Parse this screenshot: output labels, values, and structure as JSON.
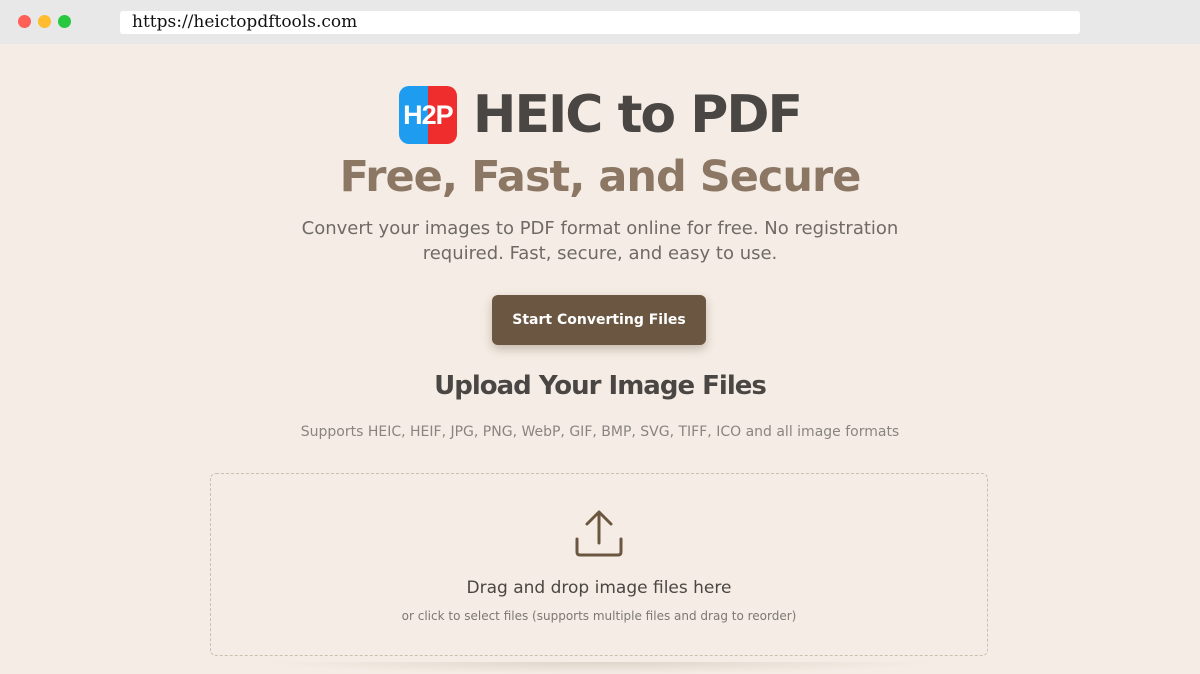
{
  "browser": {
    "url": "https://heictopdftools.com"
  },
  "hero": {
    "logo_text": "H2P",
    "title": "HEIC to PDF",
    "subtitle": "Free, Fast, and Secure",
    "description": "Convert your images to PDF format online for free. No registration required. Fast, secure, and easy to use.",
    "cta_label": "Start Converting Files"
  },
  "upload": {
    "title": "Upload Your Image Files",
    "formats": "Supports HEIC, HEIF, JPG, PNG, WebP, GIF, BMP, SVG, TIFF, ICO and all image formats",
    "dropzone_main": "Drag and drop image files here",
    "dropzone_sub": "or click to select files (supports multiple files and drag to reorder)"
  },
  "colors": {
    "background": "#f5ede5",
    "accent_brown": "#6b5641",
    "subtitle_brown": "#8b7764",
    "logo_blue": "#1e9cf0",
    "logo_red": "#f02d2d"
  },
  "icons": {
    "upload": "upload-icon"
  }
}
